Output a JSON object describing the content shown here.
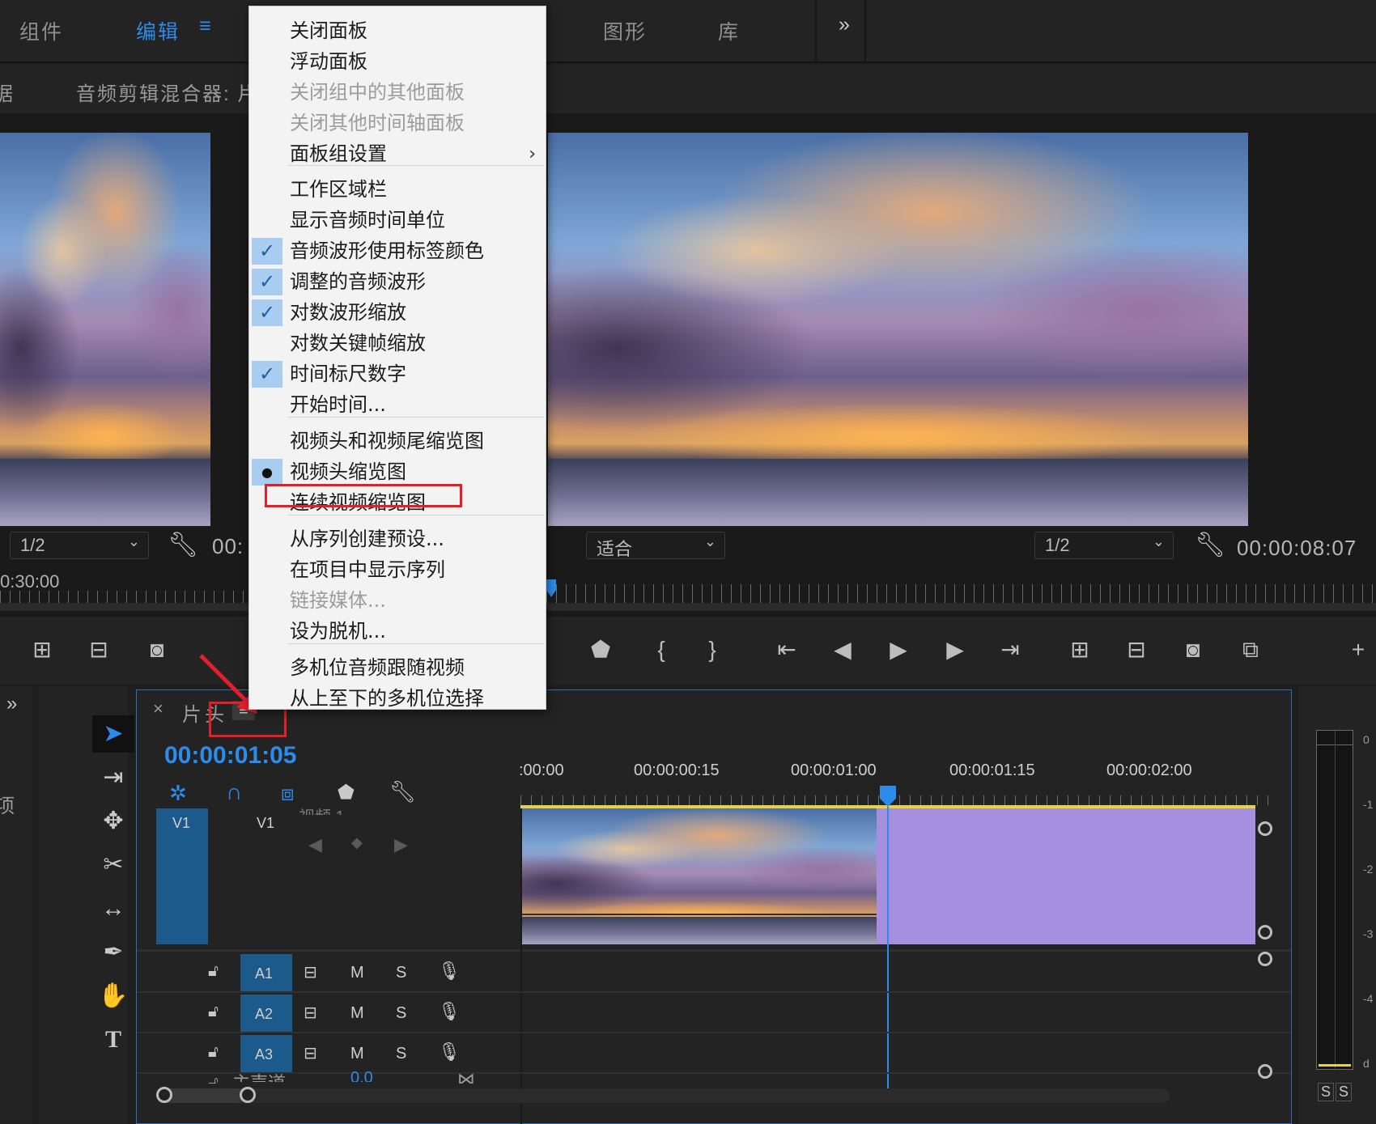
{
  "workspace_tabs": {
    "components": "组件",
    "edit": "编辑",
    "graphics": "图形",
    "libraries": "库",
    "more": "»"
  },
  "panels": {
    "left_fragment": "据",
    "audio_mixer": "音频剪辑混合器: 片"
  },
  "source_monitor": {
    "zoom": "1/2",
    "timecode_partial": "00:",
    "ruler_time": "0:30:00"
  },
  "program_monitor": {
    "fit": "适合",
    "zoom": "1/2",
    "timecode": "00:00:08:07"
  },
  "context_menu": {
    "items": [
      {
        "label": "关闭面板",
        "state": "normal"
      },
      {
        "label": "浮动面板",
        "state": "normal"
      },
      {
        "label": "关闭组中的其他面板",
        "state": "disabled"
      },
      {
        "label": "关闭其他时间轴面板",
        "state": "disabled"
      },
      {
        "label": "面板组设置",
        "state": "submenu"
      },
      {
        "label": "工作区域栏",
        "state": "normal"
      },
      {
        "label": "显示音频时间单位",
        "state": "normal"
      },
      {
        "label": "音频波形使用标签颜色",
        "state": "checked"
      },
      {
        "label": "调整的音频波形",
        "state": "checked"
      },
      {
        "label": "对数波形缩放",
        "state": "checked"
      },
      {
        "label": "对数关键帧缩放",
        "state": "normal"
      },
      {
        "label": "时间标尺数字",
        "state": "checked"
      },
      {
        "label": "开始时间...",
        "state": "normal"
      },
      {
        "label": "视频头和视频尾缩览图",
        "state": "normal"
      },
      {
        "label": "视频头缩览图",
        "state": "selected"
      },
      {
        "label": "连续视频缩览图",
        "state": "highlighted"
      },
      {
        "label": "从序列创建预设...",
        "state": "normal"
      },
      {
        "label": "在项目中显示序列",
        "state": "normal"
      },
      {
        "label": "链接媒体...",
        "state": "disabled"
      },
      {
        "label": "设为脱机...",
        "state": "normal"
      },
      {
        "label": "多机位音频跟随视频",
        "state": "normal"
      },
      {
        "label": "从上至下的多机位选择",
        "state": "normal"
      }
    ],
    "submenu_arrow": "›",
    "check_glyph": "✓",
    "bullet_glyph": "●"
  },
  "timeline": {
    "close": "×",
    "sequence_name": "片头",
    "menu_glyph": "≡",
    "timecode": "00:00:01:05",
    "ruler_labels": [
      ":00:00",
      "00:00:00:15",
      "00:00:01:00",
      "00:00:01:15",
      "00:00:02:00"
    ],
    "video_track": {
      "source_patch": "V1",
      "target": "V1",
      "name_partial": "视频 1"
    },
    "audio_tracks": [
      {
        "name": "A1",
        "m": "M",
        "s": "S"
      },
      {
        "name": "A2",
        "m": "M",
        "s": "S"
      },
      {
        "name": "A3",
        "m": "M",
        "s": "S"
      }
    ],
    "master_partial": "主声道",
    "master_value_partial": "0.0"
  },
  "left_panel": {
    "fragment_top": "»",
    "fragment_mid": "项",
    "fragment_bottom": "]"
  },
  "audio_meter": {
    "scale": [
      "0",
      "-1",
      "-2",
      "-3",
      "-4",
      "d"
    ],
    "solo": [
      "S",
      "S"
    ]
  },
  "colors": {
    "accent_blue": "#2d8ceb",
    "clip_purple": "#a78fdf",
    "track_blue": "#1c5a8c",
    "annotation_red": "#e3202a",
    "work_area_yellow": "#e9d33b"
  }
}
